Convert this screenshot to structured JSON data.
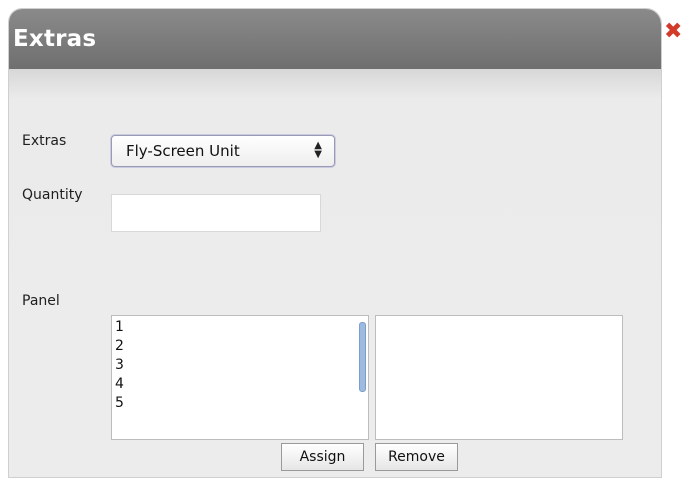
{
  "dialog": {
    "title": "Extras",
    "close_icon": "close-x-icon"
  },
  "form": {
    "extras_label": "Extras",
    "extras_selected": "Fly-Screen Unit",
    "quantity_label": "Quantity",
    "quantity_value": "",
    "panel_label": "Panel",
    "panel_options": [
      "1",
      "2",
      "3",
      "4",
      "5"
    ],
    "assigned_panels": []
  },
  "buttons": {
    "assign": "Assign",
    "remove": "Remove"
  },
  "colors": {
    "title_bar": "#7a7a7a",
    "close_icon": "#d23b2a",
    "dialog_bg": "#ececec"
  }
}
